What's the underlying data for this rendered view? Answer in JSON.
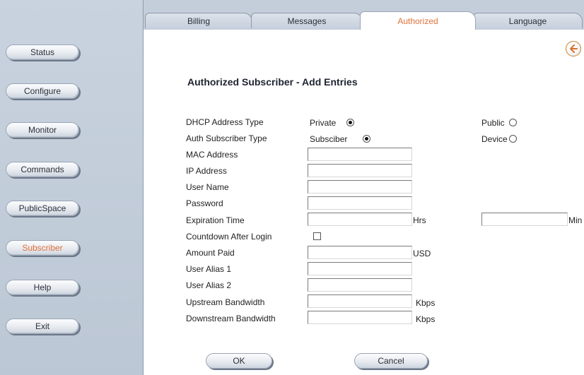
{
  "sidebar": {
    "items": [
      {
        "label": "Status"
      },
      {
        "label": "Configure"
      },
      {
        "label": "Monitor"
      },
      {
        "label": "Commands"
      },
      {
        "label": "PublicSpace"
      },
      {
        "label": "Subscriber",
        "active": true
      },
      {
        "label": "Help"
      },
      {
        "label": "Exit"
      }
    ]
  },
  "tabs": [
    {
      "label": "Billing"
    },
    {
      "label": "Messages"
    },
    {
      "label": "Authorized",
      "active": true
    },
    {
      "label": "Language"
    }
  ],
  "back_icon": "arrow-left-icon",
  "colors": {
    "accent": "#e2703a",
    "sidebar_bg": "#c4cedb",
    "content_bg": "#ffffff"
  },
  "page_title": "Authorized Subscriber - Add Entries",
  "form": {
    "dhcp_type": {
      "label": "DHCP Address Type",
      "opt1": "Private",
      "opt2": "Public",
      "selected": "Private"
    },
    "auth_type": {
      "label": "Auth Subscriber Type",
      "opt1": "Subsciber",
      "opt2": "Device",
      "selected": "Subsciber"
    },
    "mac": {
      "label": "MAC Address",
      "value": ""
    },
    "ip": {
      "label": "IP Address",
      "value": ""
    },
    "username": {
      "label": "User Name",
      "value": ""
    },
    "password": {
      "label": "Password",
      "value": ""
    },
    "expiration": {
      "label": "Expiration Time",
      "hrs_unit": "Hrs",
      "min_unit": "Min",
      "hrs_value": "",
      "min_value": ""
    },
    "countdown": {
      "label": "Countdown After Login",
      "checked": false
    },
    "amount": {
      "label": "Amount Paid",
      "unit": "USD",
      "value": ""
    },
    "alias1": {
      "label": "User Alias 1",
      "value": ""
    },
    "alias2": {
      "label": "User Alias 2",
      "value": ""
    },
    "upstream": {
      "label": "Upstream Bandwidth",
      "unit": "Kbps",
      "value": ""
    },
    "downstream": {
      "label": "Downstream Bandwidth",
      "unit": "Kbps",
      "value": ""
    }
  },
  "buttons": {
    "ok": "OK",
    "cancel": "Cancel"
  }
}
